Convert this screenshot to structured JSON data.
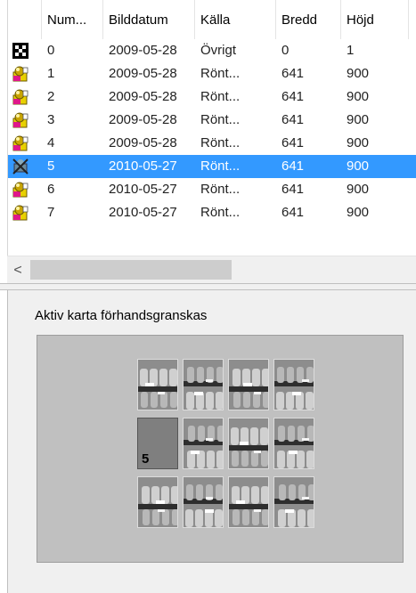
{
  "list": {
    "columns": [
      "",
      "Num...",
      "Bilddatum",
      "Källa",
      "Bredd",
      "Höjd",
      ""
    ],
    "rows": [
      {
        "icon": "checker-icon",
        "num": "0",
        "date": "2009-05-28",
        "source": "Övrigt",
        "width": "0",
        "height": "1",
        "selected": false
      },
      {
        "icon": "xray-color-icon",
        "num": "1",
        "date": "2009-05-28",
        "source": "Rönt...",
        "width": "641",
        "height": "900",
        "selected": false
      },
      {
        "icon": "xray-color-icon",
        "num": "2",
        "date": "2009-05-28",
        "source": "Rönt...",
        "width": "641",
        "height": "900",
        "selected": false
      },
      {
        "icon": "xray-color-icon",
        "num": "3",
        "date": "2009-05-28",
        "source": "Rönt...",
        "width": "641",
        "height": "900",
        "selected": false
      },
      {
        "icon": "xray-color-icon",
        "num": "4",
        "date": "2009-05-28",
        "source": "Rönt...",
        "width": "641",
        "height": "900",
        "selected": false
      },
      {
        "icon": "xray-crossed-icon",
        "num": "5",
        "date": "2010-05-27",
        "source": "Rönt...",
        "width": "641",
        "height": "900",
        "selected": true
      },
      {
        "icon": "xray-color-icon",
        "num": "6",
        "date": "2010-05-27",
        "source": "Rönt...",
        "width": "641",
        "height": "900",
        "selected": false
      },
      {
        "icon": "xray-color-icon",
        "num": "7",
        "date": "2010-05-27",
        "source": "Rönt...",
        "width": "641",
        "height": "900",
        "selected": false
      }
    ],
    "scroll_left_glyph": "<"
  },
  "preview": {
    "label": "Aktiv karta förhandsgranskas",
    "empty_tile_number": "5",
    "tile_count": 12
  },
  "colors": {
    "selection": "#3399ff",
    "preview_background": "#c0c0c0",
    "empty_tile": "#7f7f7f"
  }
}
